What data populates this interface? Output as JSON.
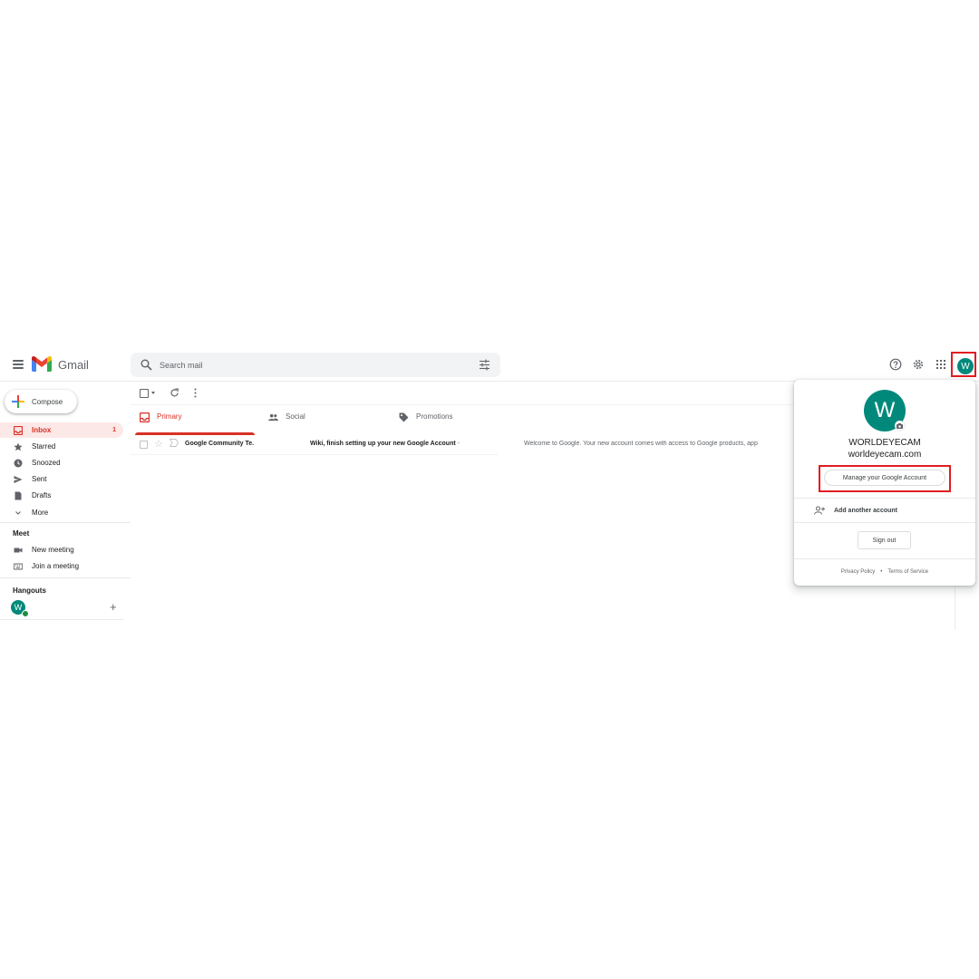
{
  "header": {
    "brand": "Gmail",
    "search_placeholder": "Search mail"
  },
  "sidebar": {
    "compose_label": "Compose",
    "items": [
      {
        "label": "Inbox",
        "count": "1",
        "icon": "inbox-icon",
        "active": true
      },
      {
        "label": "Starred",
        "icon": "star-icon"
      },
      {
        "label": "Snoozed",
        "icon": "clock-icon"
      },
      {
        "label": "Sent",
        "icon": "send-icon"
      },
      {
        "label": "Drafts",
        "icon": "draft-icon"
      },
      {
        "label": "More",
        "icon": "chevron-down-icon"
      }
    ],
    "meet": {
      "heading": "Meet",
      "items": [
        {
          "label": "New meeting",
          "icon": "video-icon"
        },
        {
          "label": "Join a meeting",
          "icon": "keyboard-icon"
        }
      ]
    },
    "hangouts": {
      "heading": "Hangouts",
      "avatar_letter": "W"
    }
  },
  "tabs": [
    {
      "label": "Primary",
      "icon": "inbox-icon",
      "active": true
    },
    {
      "label": "Social",
      "icon": "people-icon"
    },
    {
      "label": "Promotions",
      "icon": "tag-icon"
    }
  ],
  "emails": [
    {
      "sender": "Google Community Te.",
      "subject": "Wiki, finish setting up your new Google Account",
      "subject_sep": " -",
      "snippet": "Welcome to Google. Your new account comes with access to Google products, app"
    }
  ],
  "account": {
    "avatar_letter": "W",
    "name": "WORLDEYECAM",
    "email": "worldeyecam.com",
    "manage_label": "Manage your Google Account",
    "add_account_label": "Add another account",
    "sign_out_label": "Sign out",
    "privacy_label": "Privacy Policy",
    "separator": "•",
    "terms_label": "Terms of Service"
  },
  "colors": {
    "accent_red": "#d93025",
    "highlight_box": "#e11c22",
    "avatar": "#00897b"
  }
}
